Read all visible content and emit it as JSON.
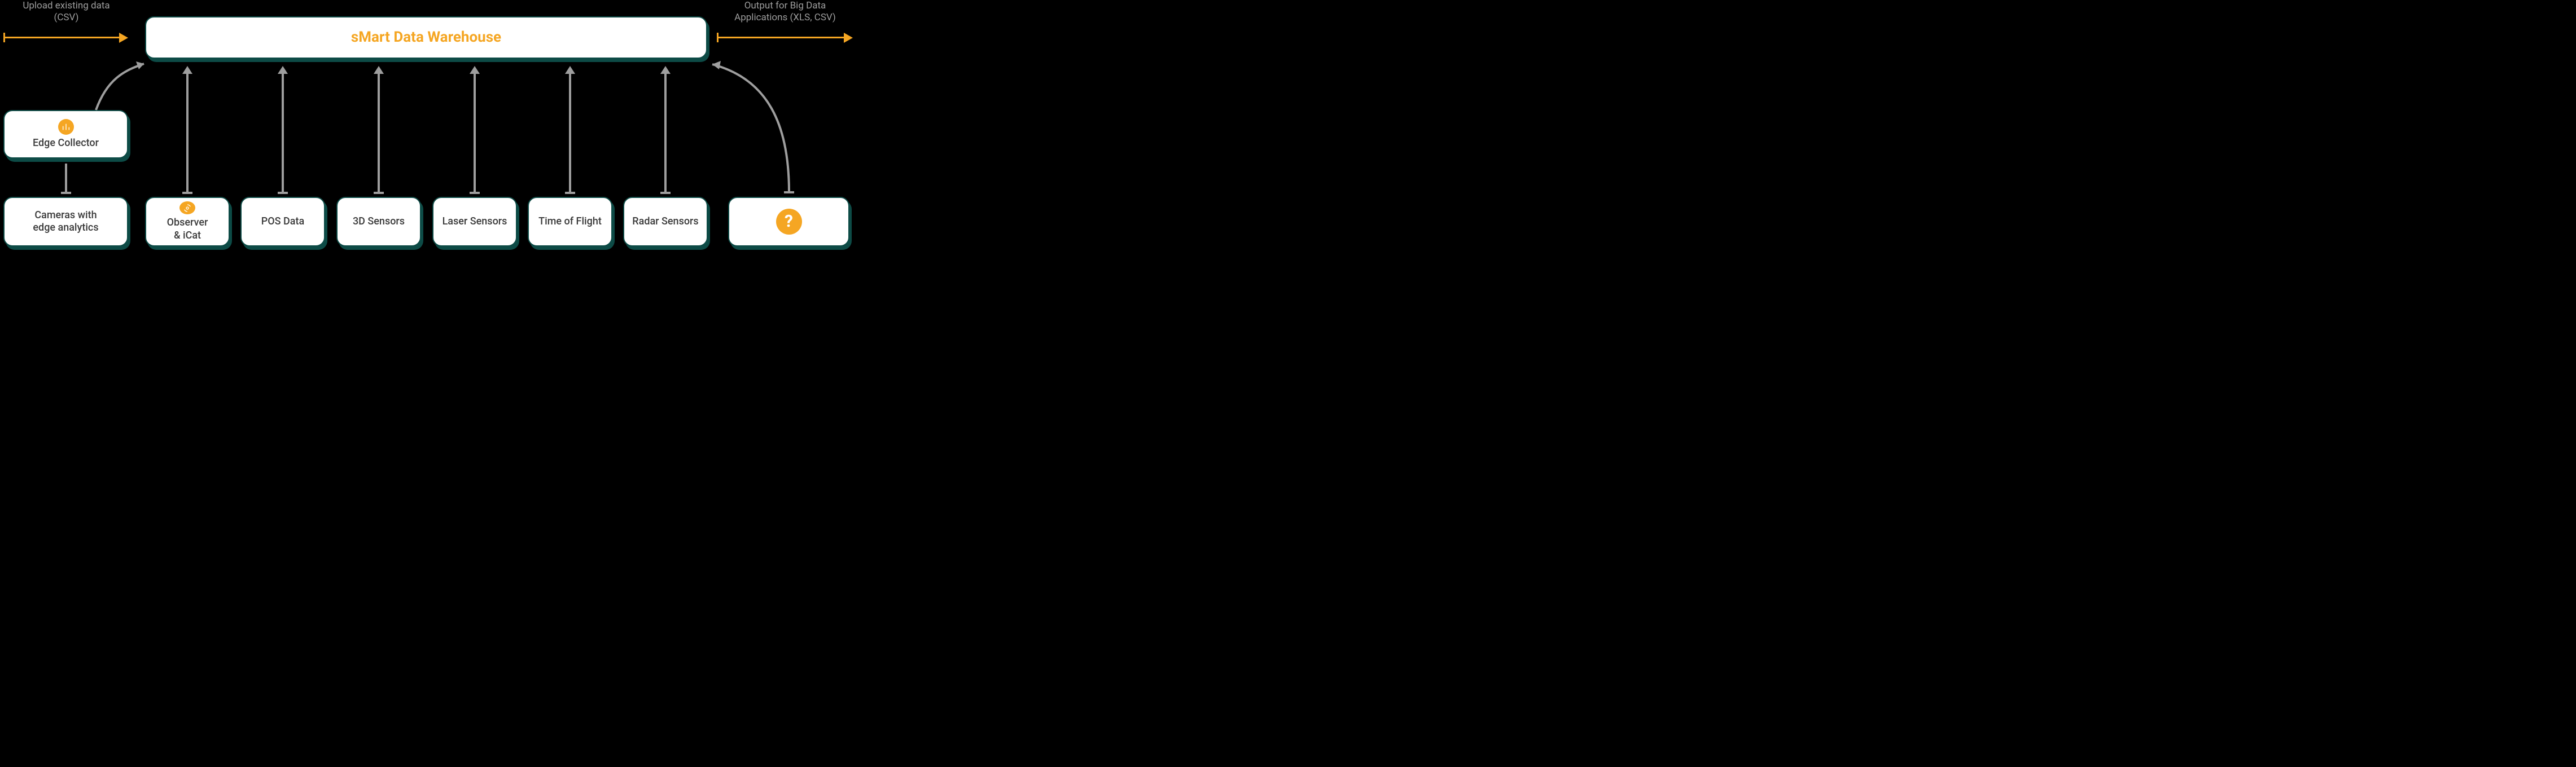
{
  "labels": {
    "upload_l1": "Upload existing data",
    "upload_l2": "(CSV)",
    "output_l1": "Output for Big Data",
    "output_l2": "Applications (XLS, CSV)"
  },
  "nodes": {
    "warehouse": "sMart Data Warehouse",
    "edge_collector": "Edge Collector",
    "cameras_l1": "Cameras with",
    "cameras_l2": "edge analytics",
    "observer_l1": "Observer",
    "observer_l2": "& iCat",
    "pos": "POS Data",
    "sensors3d": "3D Sensors",
    "laser": "Laser Sensors",
    "tof": "Time of Flight",
    "radar": "Radar Sensors",
    "question": "?"
  },
  "colors": {
    "accent": "#f5a623",
    "node_border": "#0d4b46",
    "connector": "#9e9e9e"
  }
}
